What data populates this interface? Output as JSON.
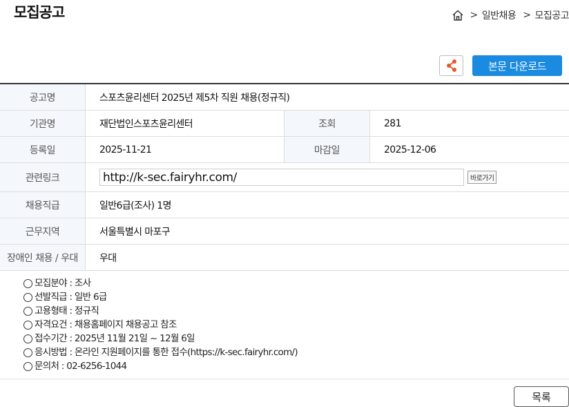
{
  "page": {
    "title": "모집공고"
  },
  "breadcrumb": {
    "items": [
      "일반채용",
      "모집공고"
    ]
  },
  "actions": {
    "download_label": "본문 다운로드",
    "list_label": "목록"
  },
  "info": {
    "title_label": "공고명",
    "title_value": "스포츠윤리센터 2025년 제5차 직원 채용(정규직)",
    "org_label": "기관명",
    "org_value": "재단법인스포츠윤리센터",
    "views_label": "조회",
    "views_value": "281",
    "reg_label": "등록일",
    "reg_value": "2025-11-21",
    "deadline_label": "마감일",
    "deadline_value": "2025-12-06",
    "link_label": "관련링크",
    "link_value": "http://k-sec.fairyhr.com/",
    "link_go_label": "바로가기",
    "grade_label": "채용직급",
    "grade_value": "일반6급(조사) 1명",
    "region_label": "근무지역",
    "region_value": "서울특별시 마포구",
    "disabled_label": "장애인 채용 / 우대",
    "disabled_value": "우대"
  },
  "details": [
    "모집분야 : 조사",
    "선발직급 : 일반 6급",
    "고용형태 : 정규직",
    "자격요건 : 채용홈페이지 채용공고 참조",
    "접수기간 : 2025년 11월 21일 ~ 12월 6일",
    "응시방법 : 온라인 지원페이지를 통한 접수(https://k-sec.fairyhr.com/)",
    "문의처 : 02-6256-1044"
  ]
}
